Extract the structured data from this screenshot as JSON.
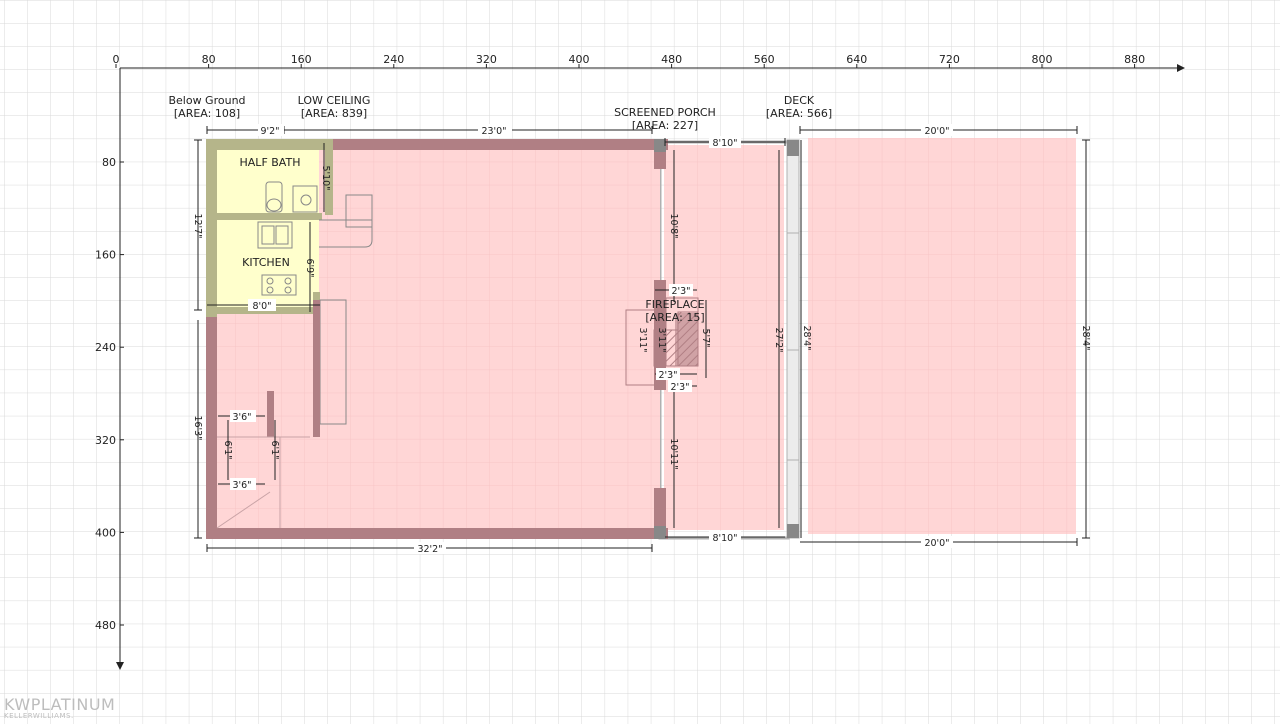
{
  "plan": {
    "ruler": {
      "x_ticks": [
        "0",
        "80",
        "160",
        "240",
        "320",
        "400",
        "480",
        "560",
        "640",
        "720",
        "800",
        "880"
      ],
      "y_ticks": [
        "80",
        "160",
        "240",
        "320",
        "400",
        "480"
      ]
    },
    "areas": {
      "below_ground": {
        "name": "Below Ground",
        "area": "[AREA: 108]"
      },
      "low_ceiling": {
        "name": "LOW CEILING",
        "area": "[AREA: 839]"
      },
      "screened_porch": {
        "name": "SCREENED PORCH",
        "area": "[AREA: 227]"
      },
      "deck": {
        "name": "DECK",
        "area": "[AREA: 566]"
      },
      "fireplace": {
        "name": "FIREPLACE",
        "area": "[AREA: 15]"
      }
    },
    "rooms": {
      "half_bath": "HALF BATH",
      "kitchen": "KITCHEN"
    },
    "dimensions": {
      "d_9_2": "9'2\"",
      "d_23_0": "23'0\"",
      "d_8_10_top": "8'10\"",
      "d_20_0_top": "20'0\"",
      "d_12_7": "12'7\"",
      "d_5_10": "5'10\"",
      "d_6_9": "6'9\"",
      "d_8_0": "8'0\"",
      "d_10_8": "10'8\"",
      "d_2_3_a": "2'3\"",
      "d_3_11_a": "3'11\"",
      "d_3_11_b": "3'11\"",
      "d_5_7": "5'7\"",
      "d_2_3_b": "2'3\"",
      "d_2_3_c": "2'3\"",
      "d_27_2": "27'2\"",
      "d_28_4_a": "28'4\"",
      "d_28_4_b": "28'4\"",
      "d_16_3": "16'3\"",
      "d_3_6_a": "3'6\"",
      "d_6_1_a": "6'1\"",
      "d_6_1_b": "6'1\"",
      "d_3_6_b": "3'6\"",
      "d_10_11": "10'11\"",
      "d_32_2": "32'2\"",
      "d_8_10_bot": "8'10\"",
      "d_20_0_bot": "20'0\""
    },
    "logo": {
      "brand": "KWPLATINUM",
      "sub": "KELLERWILLIAMS."
    },
    "colors": {
      "grid": "#d9d9d9",
      "room_fill": "#ffd6d6",
      "wall": "#b07f84",
      "bath_fill": "#ffffcc",
      "bath_wall": "#b5b58a",
      "axis": "#222222"
    }
  }
}
